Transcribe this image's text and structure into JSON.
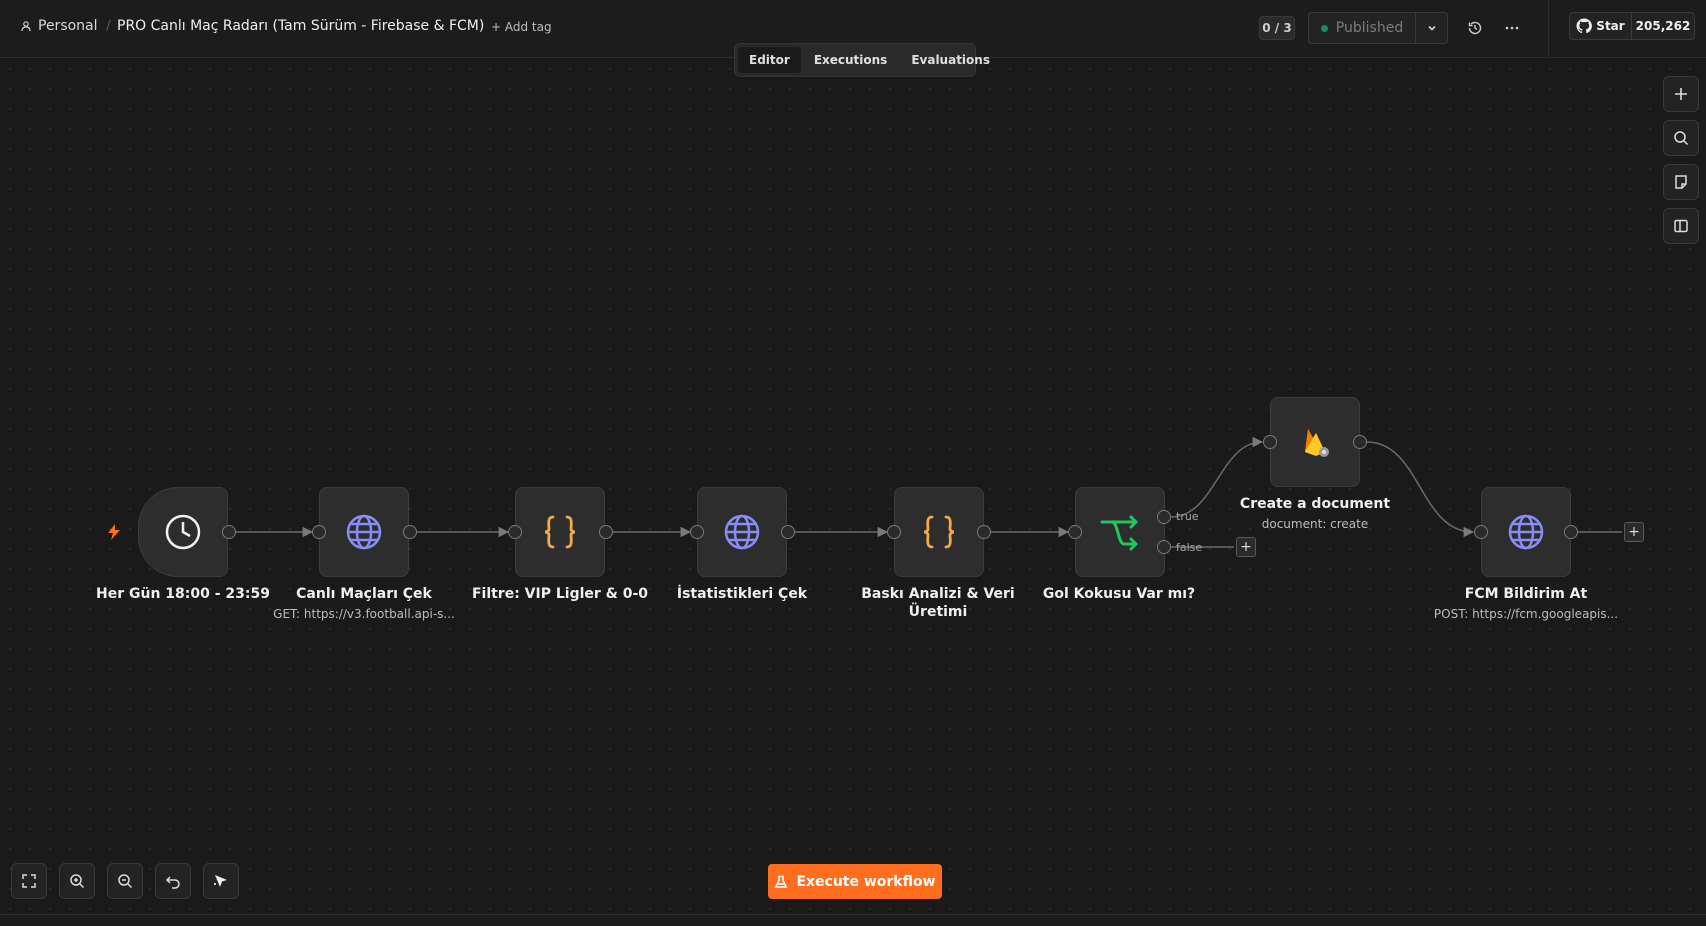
{
  "header": {
    "project": "Personal",
    "workflow_name": "PRO Canlı Maç Radarı (Tam Sürüm - Firebase & FCM)",
    "add_tag": "+ Add tag",
    "counter": "0 / 3",
    "publish_status": "Published",
    "github_star": "Star",
    "github_count": "205,262"
  },
  "tabs": [
    "Editor",
    "Executions",
    "Evaluations"
  ],
  "active_tab": "Editor",
  "nodes": [
    {
      "id": "schedule",
      "label": "Her Gün 18:00 - 23:59",
      "sub": "",
      "icon": "clock-icon"
    },
    {
      "id": "http1",
      "label": "Canlı Maçları Çek",
      "sub": "GET: https://v3.football.api-s...",
      "icon": "globe-icon"
    },
    {
      "id": "code1",
      "label": "Filtre: VIP Ligler & 0-0",
      "sub": "",
      "icon": "code-braces-icon"
    },
    {
      "id": "http2",
      "label": "İstatistikleri Çek",
      "sub": "",
      "icon": "globe-icon"
    },
    {
      "id": "code2",
      "label": "Baskı Analizi & Veri Üretimi",
      "sub": "",
      "icon": "code-braces-icon"
    },
    {
      "id": "if",
      "label": "Gol Kokusu Var mı?",
      "sub": "",
      "icon": "if-branch-icon"
    },
    {
      "id": "firebase",
      "label": "Create a document",
      "sub": "document: create",
      "icon": "firebase-icon"
    },
    {
      "id": "http3",
      "label": "FCM Bildirim At",
      "sub": "POST: https://fcm.googleapis...",
      "icon": "globe-icon"
    }
  ],
  "branches": {
    "true": "true",
    "false": "false"
  },
  "execute_button": "Execute workflow",
  "colors": {
    "accent": "#ff6d1f",
    "globe": "#8a8cf5",
    "code": "#f2a94a",
    "if": "#22c55e",
    "published_dot": "#1e8a5f"
  }
}
